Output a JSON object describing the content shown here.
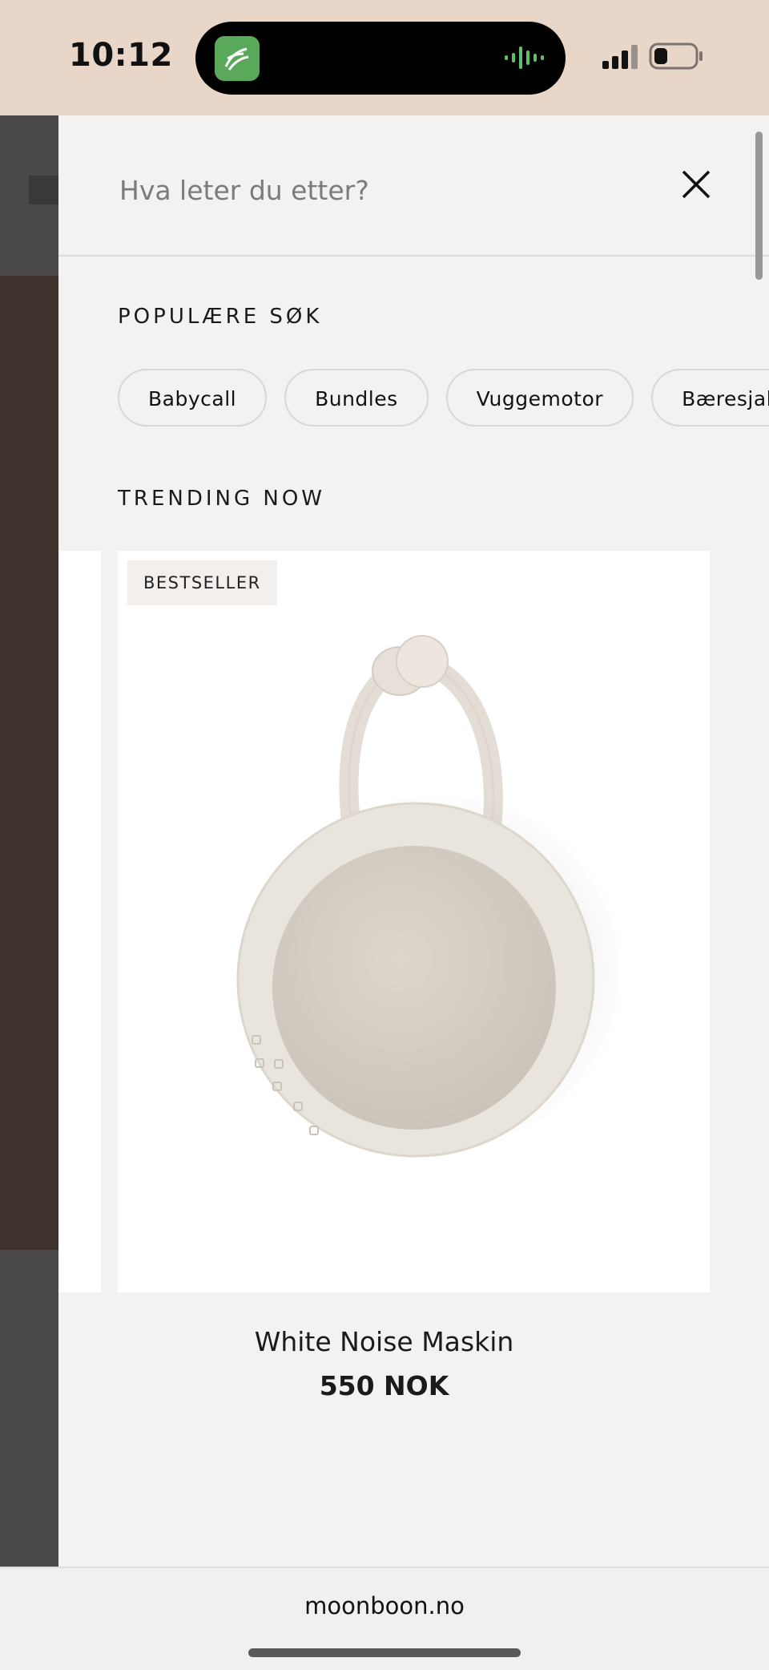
{
  "status_bar": {
    "time": "10:12"
  },
  "search": {
    "placeholder": "Hva leter du etter?"
  },
  "popular": {
    "title": "POPULÆRE SØK",
    "chips": [
      "Babycall",
      "Bundles",
      "Vuggemotor",
      "Bæresjal"
    ]
  },
  "trending": {
    "title": "TRENDING NOW",
    "product": {
      "badge": "BESTSELLER",
      "name": "White Noise Maskin",
      "price": "550 NOK"
    }
  },
  "browser": {
    "url": "moonboon.no"
  },
  "icons": {
    "close": "close-icon",
    "signal": "signal-icon",
    "battery": "battery-icon",
    "app": "app-icon",
    "audio": "audio-wave-icon"
  },
  "colors": {
    "status_bar": "#e8d6c8",
    "panel_bg": "#f3f2f1",
    "app_icon": "#5aa95a",
    "audio_wave": "#5fbf6a"
  }
}
